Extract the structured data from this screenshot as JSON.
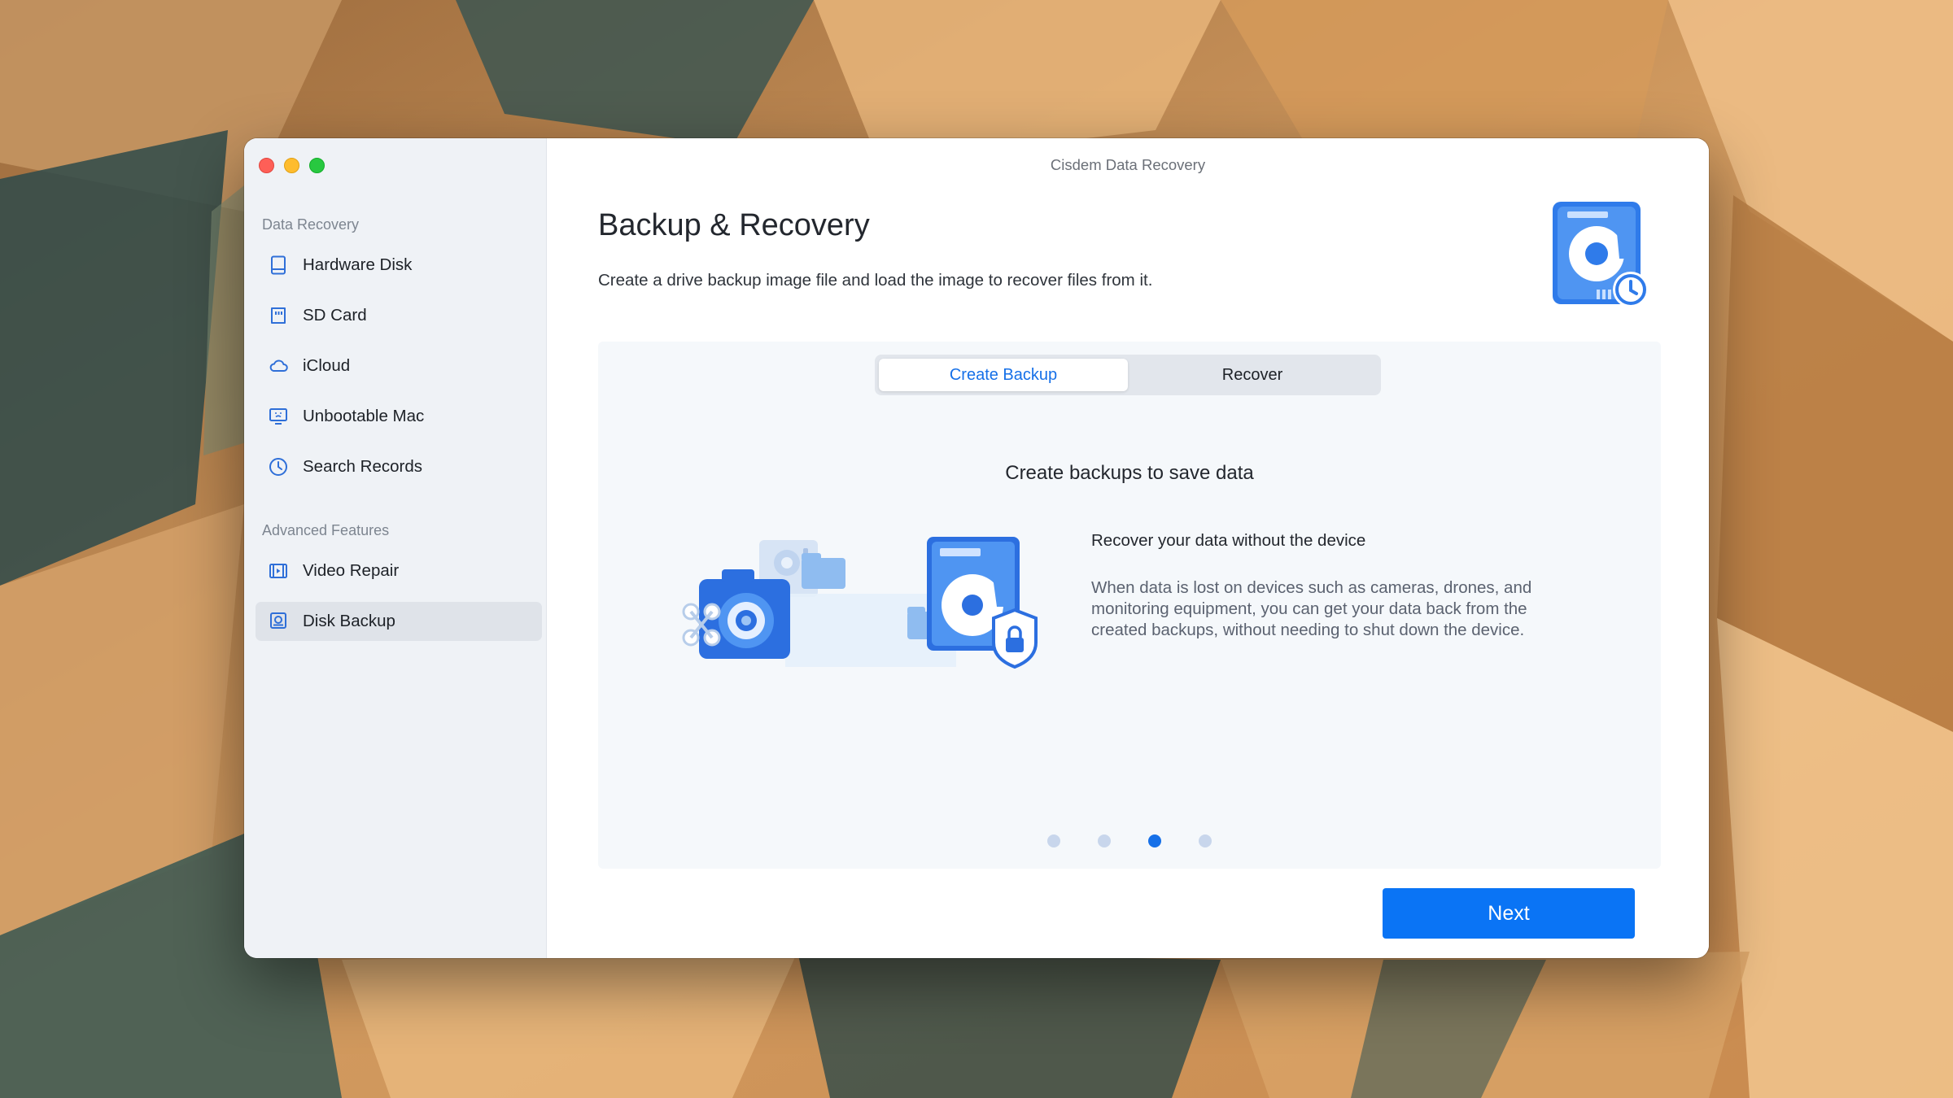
{
  "window": {
    "title": "Cisdem Data Recovery"
  },
  "sidebar": {
    "sections": [
      {
        "title": "Data Recovery",
        "items": [
          {
            "label": "Hardware Disk",
            "icon": "hard-disk-icon"
          },
          {
            "label": "SD Card",
            "icon": "sd-card-icon"
          },
          {
            "label": "iCloud",
            "icon": "cloud-icon"
          },
          {
            "label": "Unbootable Mac",
            "icon": "monitor-icon"
          },
          {
            "label": "Search Records",
            "icon": "clock-icon"
          }
        ]
      },
      {
        "title": "Advanced Features",
        "items": [
          {
            "label": "Video Repair",
            "icon": "film-icon"
          },
          {
            "label": "Disk Backup",
            "icon": "disk-backup-icon",
            "active": true
          }
        ]
      }
    ]
  },
  "main": {
    "title": "Backup & Recovery",
    "subtitle": "Create a drive backup image file and load the image to recover files from it.",
    "tabs": [
      {
        "label": "Create Backup",
        "active": true
      },
      {
        "label": "Recover",
        "active": false
      }
    ],
    "slide": {
      "title": "Create backups to save data",
      "heading": "Recover your data without the device",
      "text": "When data is lost on devices such as cameras, drones, and monitoring equipment, you can get your data back from the created backups, without needing to shut down the device."
    },
    "pagination": {
      "total": 4,
      "current": 3
    },
    "next_label": "Next"
  },
  "colors": {
    "accent": "#0a74f5",
    "sidebar_bg": "#eff2f6",
    "panel_bg": "#f5f8fb",
    "icon_blue": "#2f6fd8"
  }
}
